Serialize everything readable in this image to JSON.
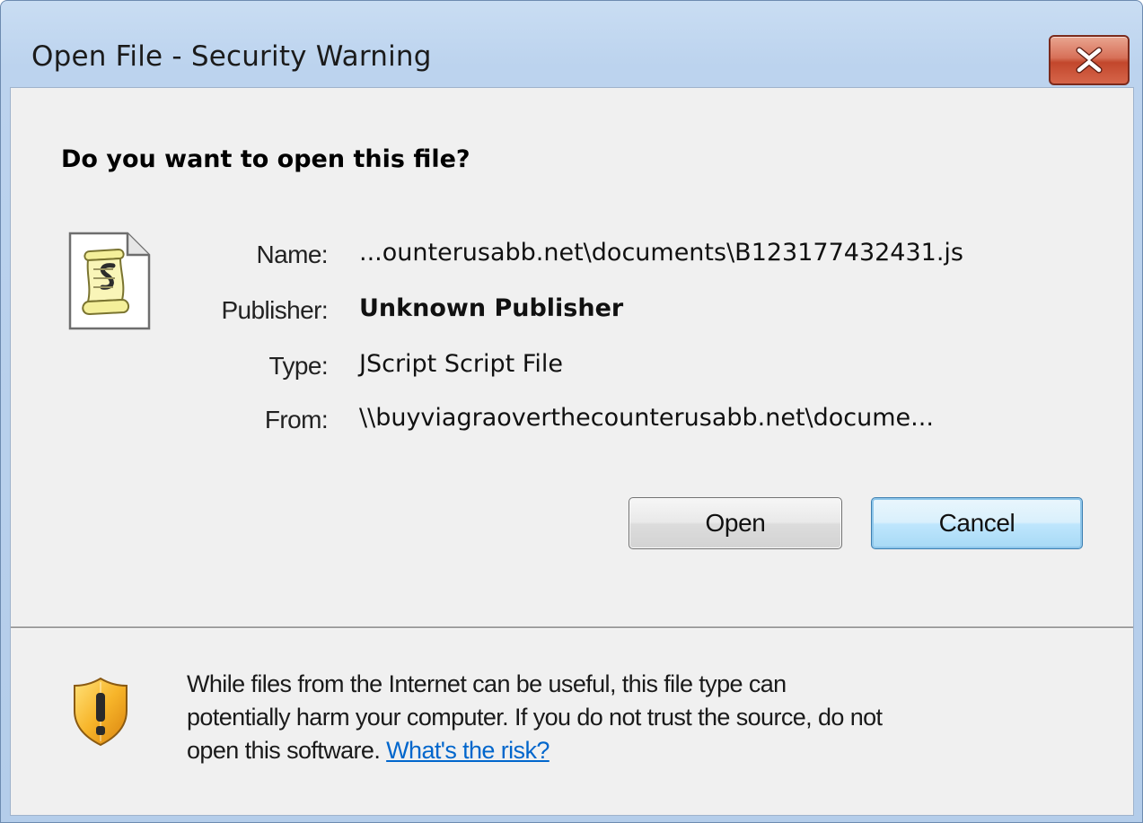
{
  "window": {
    "title": "Open File - Security Warning"
  },
  "dialog": {
    "question": "Do you want to open this file?",
    "fields": {
      "name_label": "Name:",
      "name_value": "...ounterusabb.net\\documents\\B123177432431.js",
      "publisher_label": "Publisher:",
      "publisher_value": "Unknown Publisher",
      "type_label": "Type:",
      "type_value": "JScript Script File",
      "from_label": "From:",
      "from_value": "\\\\buyviagraoverthecounterusabb.net\\docume..."
    },
    "buttons": {
      "open_label": "Open",
      "cancel_label": "Cancel"
    },
    "warning": {
      "line1": "While files from the Internet can be useful, this file type can",
      "line2": "potentially harm your computer. If you do not trust the source, do not",
      "line3_prefix": "open this software.",
      "risk_link": "What's the risk?"
    }
  },
  "icons": {
    "file": "script-file-icon",
    "close": "close-icon",
    "warning": "warning-shield-icon"
  },
  "colors": {
    "close_button": "#c9503a",
    "link": "#0066cc",
    "cancel_border": "#3c7fb1",
    "shield": "#f0a81e"
  }
}
